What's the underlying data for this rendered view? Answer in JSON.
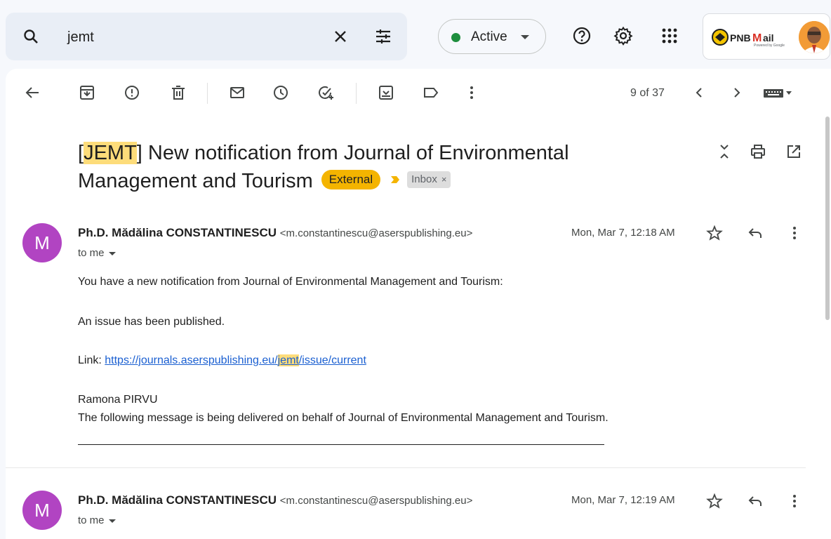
{
  "search": {
    "value": "jemt"
  },
  "status": {
    "label": "Active",
    "color": "#1e8e3e"
  },
  "brand": {
    "logo_text": "PNBMail",
    "logo_sub": "Powered by Google"
  },
  "toolbar": {
    "count": "9 of 37"
  },
  "email": {
    "subject_tag": "JEMT",
    "subject_rest": "] New notification from Journal of Environmental Management and Tourism",
    "subject_open": "[",
    "label_external": "External",
    "label_inbox": "Inbox",
    "label_inbox_close": "×"
  },
  "messages": [
    {
      "avatar": "M",
      "sender": "Ph.D. Mădălina CONSTANTINESCU",
      "address": "<m.constantinescu@aserspublishing.eu>",
      "date": "Mon, Mar 7, 12:18 AM",
      "to": "to me",
      "line1": "You have a new notification from Journal of Environmental Management and Tourism:",
      "line2": "An issue has been published.",
      "link_label": "Link: ",
      "link_a": "https://journals.aserspublishing.eu/",
      "link_b": "jemt",
      "link_c": "/issue/current",
      "signer": "Ramona PIRVU",
      "footer": "The following message is being delivered on behalf of Journal of Environmental Management and Tourism."
    },
    {
      "avatar": "M",
      "sender": "Ph.D. Mădălina CONSTANTINESCU",
      "address": "<m.constantinescu@aserspublishing.eu>",
      "date": "Mon, Mar 7, 12:19 AM",
      "to": "to me"
    }
  ]
}
